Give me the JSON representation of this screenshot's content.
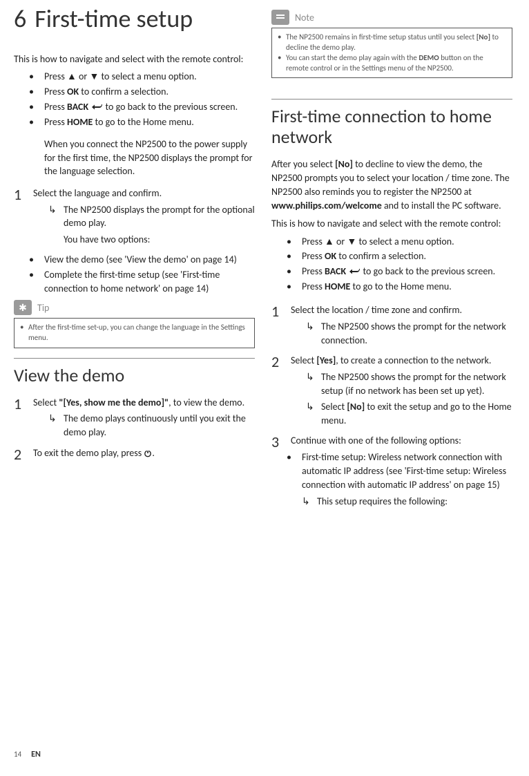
{
  "chapter": {
    "number": "6",
    "title": "First-time setup"
  },
  "footer": {
    "pageno": "14",
    "lang": "EN"
  },
  "left": {
    "intro1": "This is how to navigate and select with the remote control:",
    "nav": {
      "b1a": "Press ",
      "b1b": " or ",
      "b1c": " to select a menu option.",
      "b2a": "Press ",
      "b2b": "OK",
      "b2c": " to confirm a selection.",
      "b3a": "Press ",
      "b3b": "BACK",
      "b3c": " to go back to the previous screen.",
      "b4a": "Press ",
      "b4b": "HOME",
      "b4c": " to go to the Home menu."
    },
    "connectpara": "When you connect the NP2500 to the power supply for the first time, the NP2500 displays the prompt for the language selection.",
    "step1": {
      "text": "Select the language and confirm.",
      "result": "The NP2500 displays the prompt for the optional demo play.",
      "sub": "You have two options:"
    },
    "opts": {
      "o1": "View the demo (see 'View the demo' on page 14)",
      "o2": "Complete the first-time setup (see 'First-time connection to home network' on page 14)"
    },
    "tip": {
      "label": "Tip",
      "item1": "After the first-time set-up, you can change the language in the Settings menu."
    },
    "sectionViewDemo": "View the demo",
    "vd": {
      "s1a": "Select ",
      "s1b": "\"[Yes, show me the demo]\"",
      "s1c": ", to view the demo.",
      "s1r": "The demo plays continuously until you exit the demo play.",
      "s2a": "To exit the demo play, press ",
      "s2b": "."
    }
  },
  "right": {
    "note": {
      "label": "Note",
      "i1a": "The NP2500 remains in first-time setup status until you select ",
      "i1b": "[No]",
      "i1c": " to decline the demo play.",
      "i2a": "You can start the demo play again with the ",
      "i2b": "DEMO",
      "i2c": " button on the remote control or in the Settings menu of the NP2500."
    },
    "sectionConn": "First-time connection to home network",
    "para1a": "After you select ",
    "para1b": "[No]",
    "para1c": " to decline to view the demo, the NP2500 prompts you to select your location / time zone. The NP2500 also reminds you to register the NP2500 at ",
    "para1d": "www.philips.com/welcome",
    "para1e": " and to install the PC software.",
    "intro2": "This is how to navigate and select with the remote control:",
    "nav": {
      "b1a": "Press ",
      "b1b": " or ",
      "b1c": " to select a menu option.",
      "b2a": "Press ",
      "b2b": "OK",
      "b2c": " to confirm a selection.",
      "b3a": "Press ",
      "b3b": "BACK",
      "b3c": " to go back to the previous screen.",
      "b4a": "Press ",
      "b4b": "HOME",
      "b4c": " to go to the Home menu."
    },
    "s1": {
      "text": "Select the location / time zone and confirm.",
      "r": "The NP2500 shows the prompt for the network connection."
    },
    "s2": {
      "a": "Select ",
      "b": "[Yes]",
      "c": ", to create a connection to the network.",
      "r1": "The NP2500 shows the prompt for the network setup (if no network has been set up yet).",
      "r2a": "Select ",
      "r2b": "[No]",
      "r2c": " to exit the setup and go to the Home menu."
    },
    "s3": {
      "text": "Continue with one of the following options:",
      "opt1": "First-time setup: Wireless network connection with automatic IP address (see 'First-time setup: Wireless connection with automatic IP address' on page 15)",
      "r": "This setup requires the following:"
    }
  }
}
